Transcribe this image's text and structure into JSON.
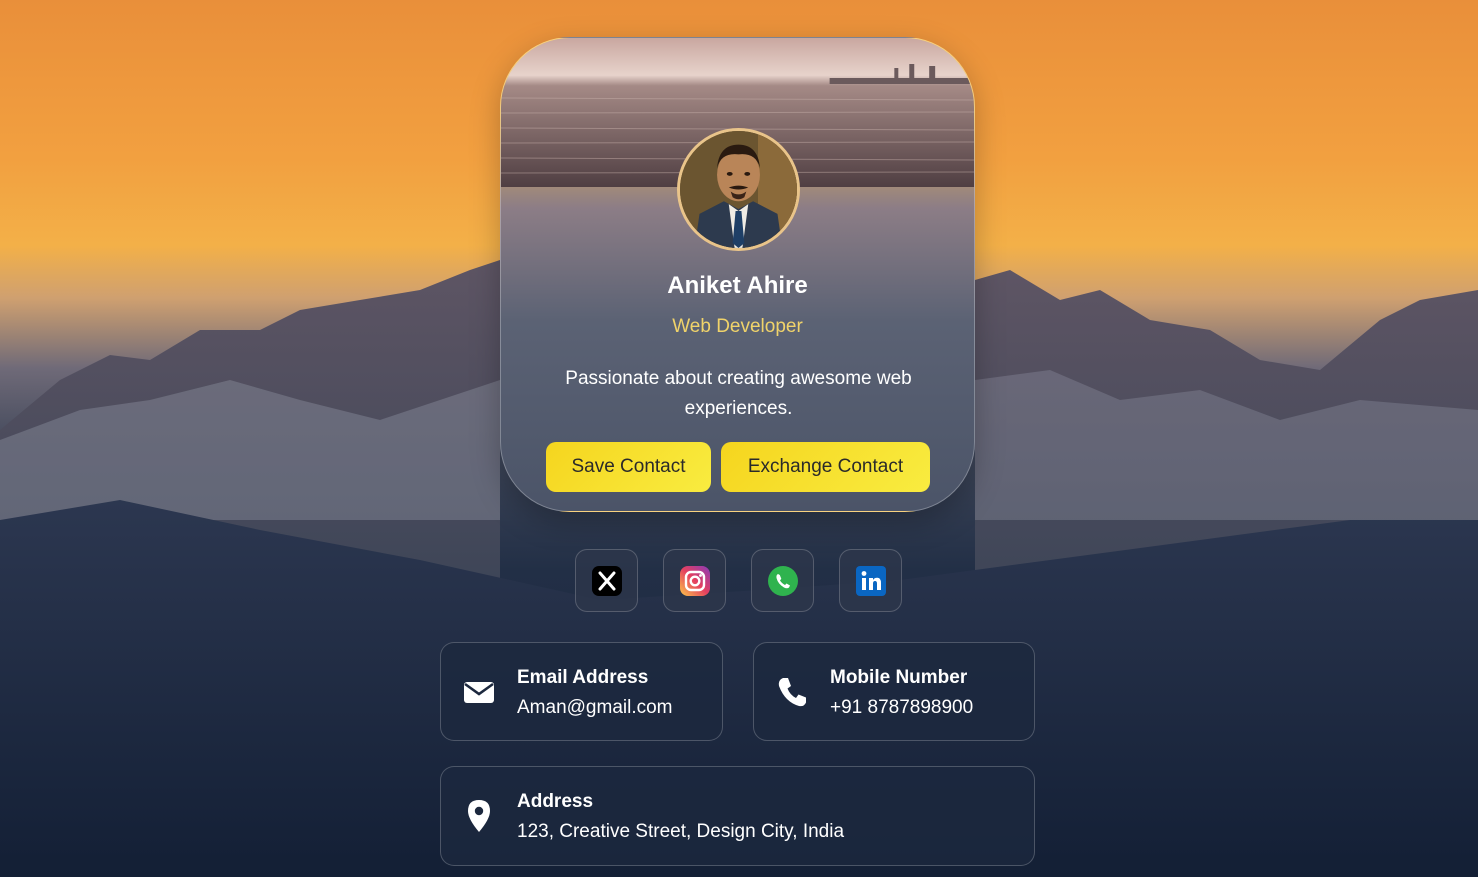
{
  "profile": {
    "name": "Aniket Ahire",
    "role": "Web Developer",
    "bio": "Passionate about creating awesome web experiences."
  },
  "actions": {
    "save_label": "Save Contact",
    "exchange_label": "Exchange Contact"
  },
  "socials": [
    {
      "icon": "x-twitter-icon",
      "color": "#000000"
    },
    {
      "icon": "instagram-icon",
      "color": "#d6249f"
    },
    {
      "icon": "whatsapp-icon",
      "color": "#25d366"
    },
    {
      "icon": "linkedin-icon",
      "color": "#0a66c2"
    }
  ],
  "contact": {
    "email": {
      "label": "Email Address",
      "value": "Aman@gmail.com",
      "icon": "envelope-icon"
    },
    "mobile": {
      "label": "Mobile Number",
      "value": "+91 8787898900",
      "icon": "phone-icon"
    },
    "address": {
      "label": "Address",
      "value": "123, Creative Street, Design City, India",
      "icon": "map-pin-icon"
    }
  },
  "colors": {
    "accent": "#f5d51e",
    "role_text": "#f0d36a"
  }
}
